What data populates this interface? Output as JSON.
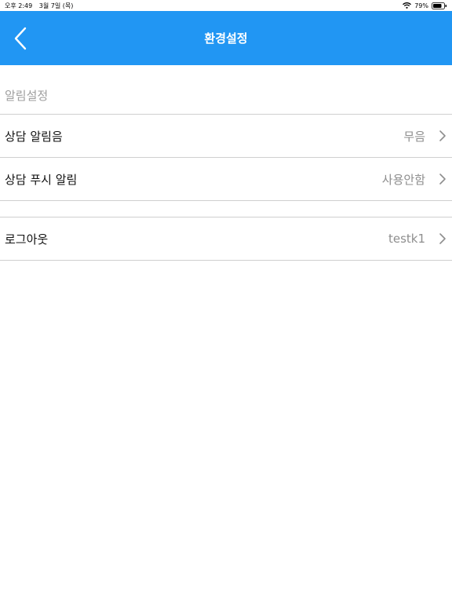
{
  "status_bar": {
    "time": "오후 2:49",
    "date": "3월 7일 (목)",
    "battery": "79%"
  },
  "nav": {
    "title": "환경설정"
  },
  "sections": [
    {
      "header": "알림설정",
      "rows": [
        {
          "label": "상담 알림음",
          "value": "무음"
        },
        {
          "label": "상담 푸시 알림",
          "value": "사용안함"
        }
      ]
    },
    {
      "rows": [
        {
          "label": "로그아웃",
          "value": "testk1"
        }
      ]
    }
  ],
  "colors": {
    "nav_background": "#2196f3",
    "divider": "#cfcfcf",
    "secondary_text": "#8e8e8e"
  }
}
